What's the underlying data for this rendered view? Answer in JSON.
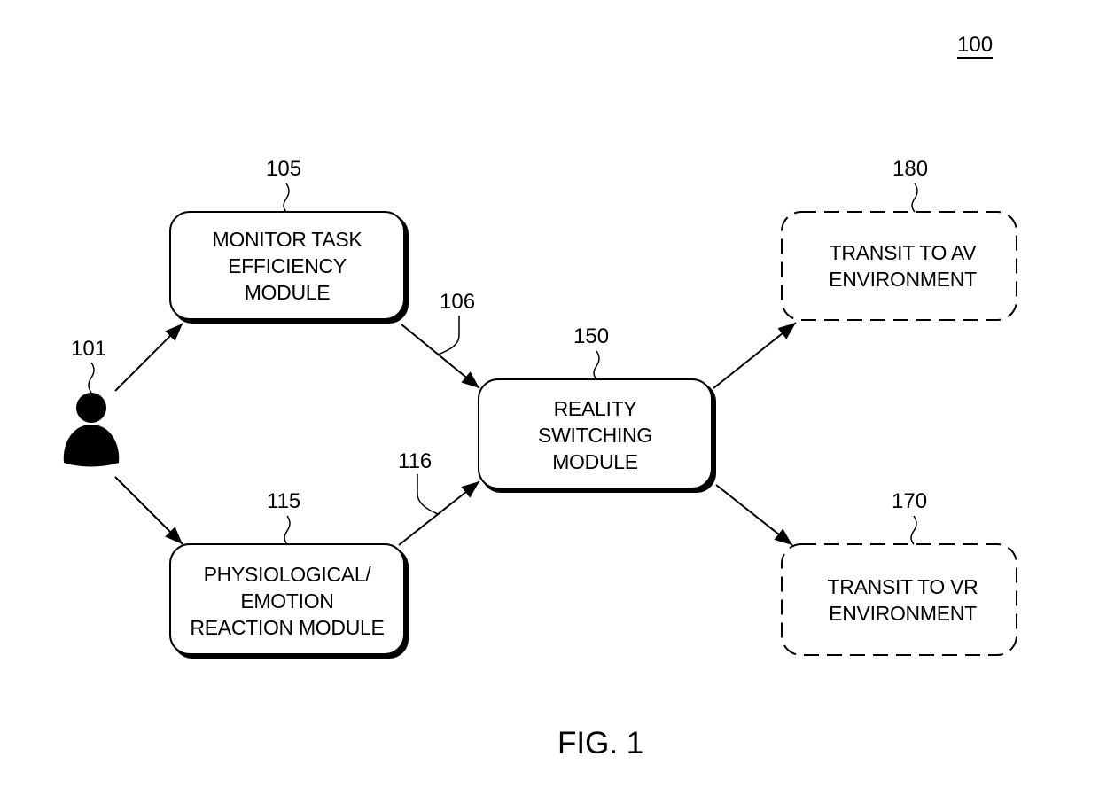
{
  "figure": {
    "number": "100",
    "caption": "FIG. 1"
  },
  "user": {
    "ref": "101",
    "icon": "person-icon"
  },
  "boxes": {
    "monitor": {
      "ref": "105",
      "lines": [
        "MONITOR TASK",
        "EFFICIENCY",
        "MODULE"
      ],
      "style": "solid"
    },
    "physio": {
      "ref": "115",
      "lines": [
        "PHYSIOLOGICAL/",
        "EMOTION",
        "REACTION MODULE"
      ],
      "style": "solid"
    },
    "reality": {
      "ref": "150",
      "lines": [
        "REALITY",
        "SWITCHING",
        "MODULE"
      ],
      "style": "solid"
    },
    "av": {
      "ref": "180",
      "lines": [
        "TRANSIT TO AV",
        "ENVIRONMENT"
      ],
      "style": "dashed"
    },
    "vr": {
      "ref": "170",
      "lines": [
        "TRANSIT TO VR",
        "ENVIRONMENT"
      ],
      "style": "dashed"
    }
  },
  "connections": [
    {
      "from": "user",
      "to": "monitor",
      "ref": ""
    },
    {
      "from": "user",
      "to": "physio",
      "ref": ""
    },
    {
      "from": "monitor",
      "to": "reality",
      "ref": "106"
    },
    {
      "from": "physio",
      "to": "reality",
      "ref": "116"
    },
    {
      "from": "reality",
      "to": "av",
      "ref": ""
    },
    {
      "from": "reality",
      "to": "vr",
      "ref": ""
    }
  ]
}
